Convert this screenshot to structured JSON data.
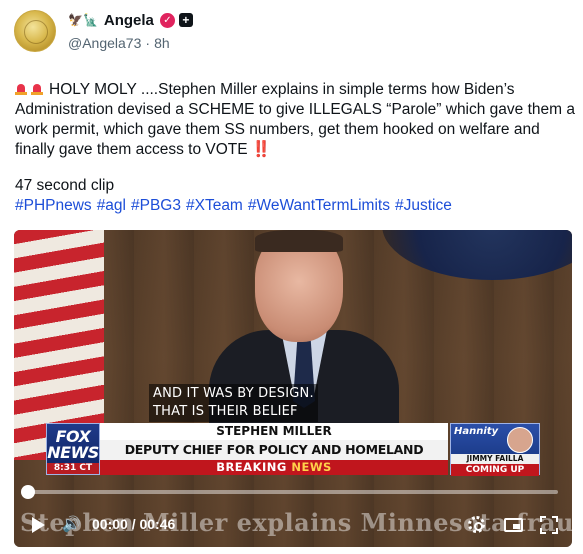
{
  "post": {
    "author": {
      "emoji_prefix": "🦅🗽",
      "name": "Angela",
      "handle": "@Angela73",
      "separator": "·",
      "time": "8h"
    },
    "text_main": "HOLY MOLY ....Stephen Miller explains in simple terms how Biden’s Administration devised a SCHEME to give ILLEGALS “Parole” which gave them a work permit, which gave them SS numbers, get them hooked on welfare and finally gave them access to VOTE",
    "text_end_emoji": "‼️",
    "clip_line": "47 second clip",
    "hashtags": [
      "#PHPnews",
      "#agl",
      "#PBG3",
      "#XTeam",
      "#WeWantTermLimits",
      "#Justice"
    ]
  },
  "video": {
    "caption_line1": "AND IT WAS BY DESIGN.",
    "caption_line2": "THAT IS THEIR BELIEF",
    "network_line1": "FOX",
    "network_line2": "NEWS",
    "network_time": "8:31 CT",
    "chyron_name": "STEPHEN MILLER",
    "chyron_title": "DEPUTY CHIEF FOR POLICY AND HOMELAND SECURITY ADVISOR",
    "breaking_word": "BREAKING",
    "news_word": "NEWS",
    "side_show": "Hannity",
    "side_guest": "JIMMY FAILLA",
    "side_status": "COMING UP",
    "overlay_title": "Stephen Miller explains Minnesota fraud",
    "current_time": "00:00",
    "duration": "00:46",
    "progress_fraction": 0.0,
    "controls": {
      "play": "play-icon",
      "volume": "volume-icon",
      "settings": "gear-icon",
      "pip": "picture-in-picture-icon",
      "fullscreen": "fullscreen-icon"
    }
  },
  "colors": {
    "hashtag": "#1d4ed8",
    "handle_gray": "#536471",
    "verified_badge": "#e0245e",
    "breaking_red": "#c0161d"
  }
}
